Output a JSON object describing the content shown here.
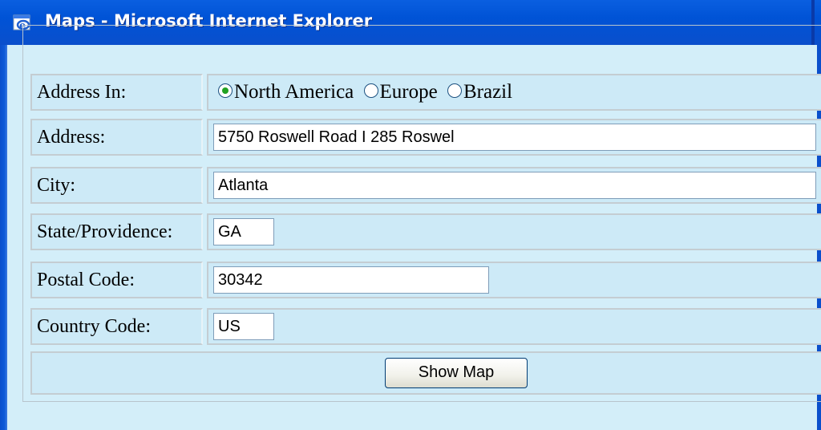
{
  "window": {
    "title": "Maps - Microsoft Internet Explorer",
    "icon": "ie-icon"
  },
  "form": {
    "address_in": {
      "label": "Address In:",
      "options": [
        {
          "label": "North America",
          "checked": true
        },
        {
          "label": "Europe",
          "checked": false
        },
        {
          "label": "Brazil",
          "checked": false
        }
      ]
    },
    "address": {
      "label": "Address:",
      "value": "5750 Roswell Road I 285 Roswel"
    },
    "city": {
      "label": "City:",
      "value": "Atlanta"
    },
    "state": {
      "label": "State/Providence:",
      "value": "GA"
    },
    "postal": {
      "label": "Postal Code:",
      "value": "30342"
    },
    "country": {
      "label": "Country Code:",
      "value": "US"
    },
    "submit_label": "Show Map"
  },
  "colors": {
    "titlebar": "#0053d6",
    "page_background": "#d3eef9",
    "radio_checked": "#21a121"
  }
}
